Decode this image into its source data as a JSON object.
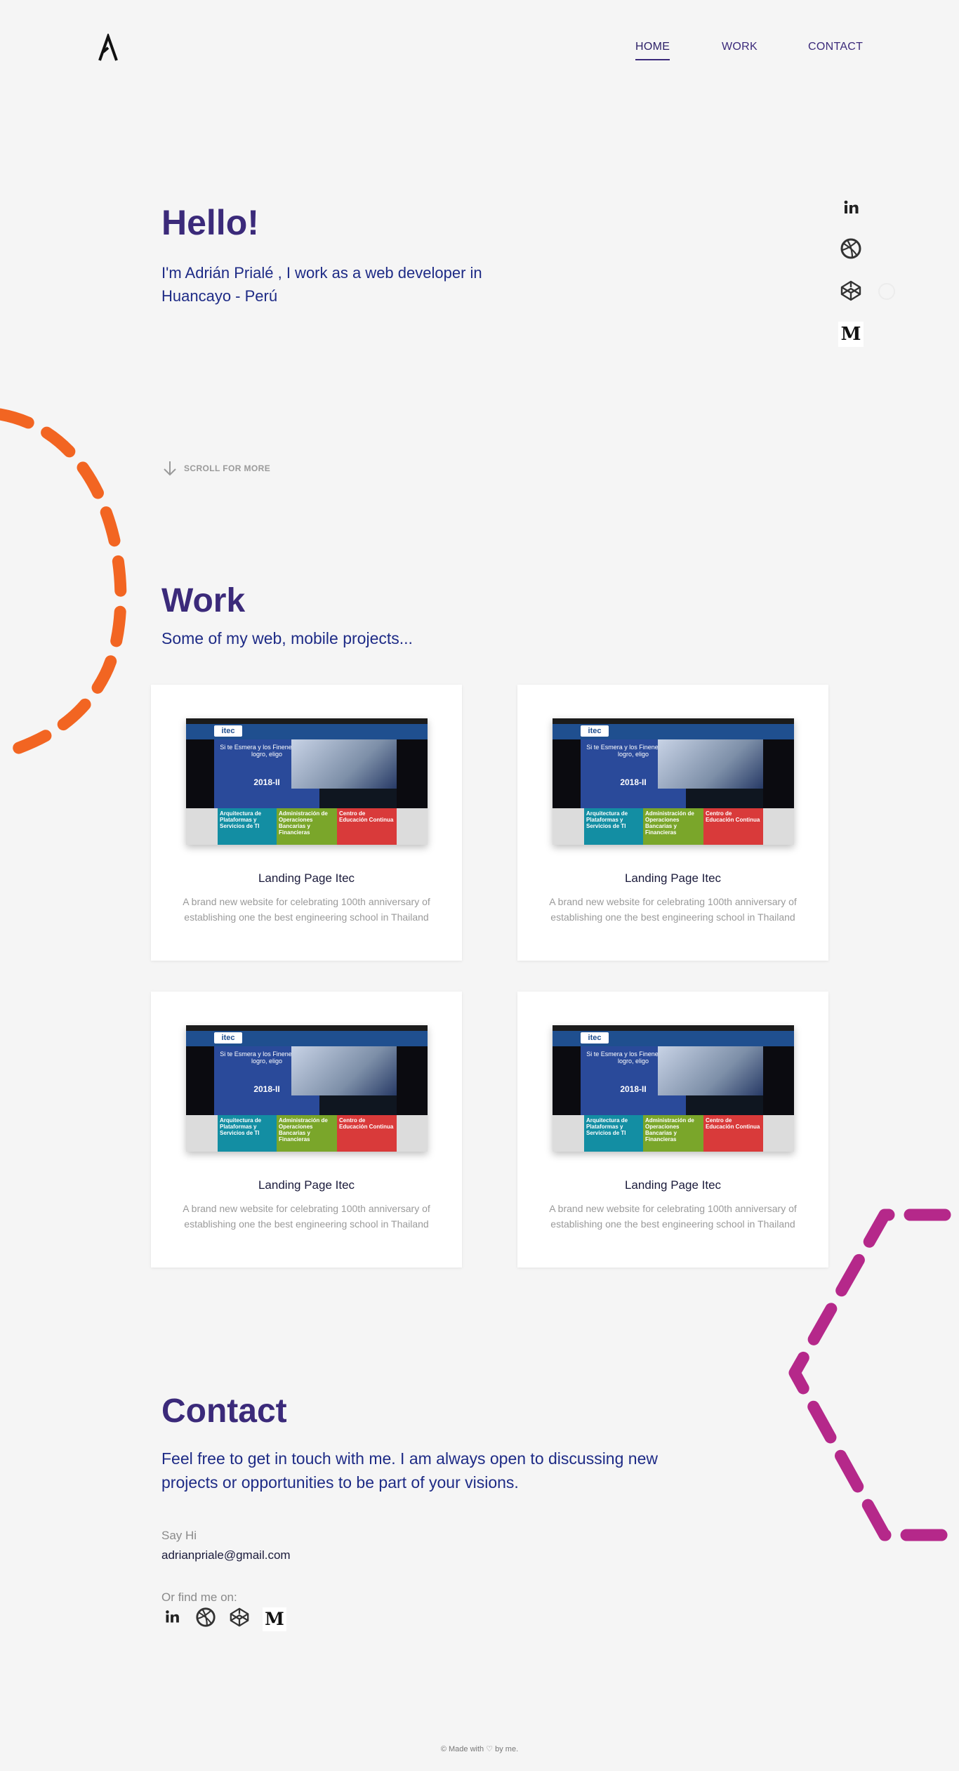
{
  "header": {
    "logo_letter": "A",
    "nav": [
      {
        "label": "HOME",
        "active": true
      },
      {
        "label": "WORK",
        "active": false
      },
      {
        "label": "CONTACT",
        "active": false
      }
    ]
  },
  "hero": {
    "title": "Hello!",
    "intro": "I'm Adrián Prialé , I work as a web developer in Huancayo - Perú",
    "scroll_hint": "SCROLL FOR MORE"
  },
  "social": [
    {
      "name": "linkedin-icon",
      "glyph": "in"
    },
    {
      "name": "dribbble-icon",
      "glyph": ""
    },
    {
      "name": "codepen-icon",
      "glyph": ""
    },
    {
      "name": "medium-icon",
      "glyph": "M"
    }
  ],
  "work": {
    "title": "Work",
    "subtitle": "Some of my web, mobile projects...",
    "projects": [
      {
        "title": "Landing Page Itec",
        "description": "A brand new website for celebrating 100th anniversary of establishing one the best engineering school in Thailand"
      },
      {
        "title": "Landing Page Itec",
        "description": "A brand new website for celebrating 100th anniversary of establishing one the best engineering school in Thailand"
      },
      {
        "title": "Landing Page Itec",
        "description": "A brand new website for celebrating 100th anniversary of establishing one the best engineering school in Thailand"
      },
      {
        "title": "Landing Page Itec",
        "description": "A brand new website for celebrating 100th anniversary of establishing one the best engineering school in Thailand"
      }
    ],
    "screenshot": {
      "brand": "itec",
      "term": "2018-II",
      "tagline": "Si te Esmera y los Fineness en lo logro, eligo",
      "tiles": [
        "Arquitectura de Plataformas y Servicios de TI",
        "Administración de Operaciones Bancarias y Financieras",
        "Centro de Educación Continua"
      ]
    }
  },
  "contact": {
    "title": "Contact",
    "text": "Feel free to get in touch with me. I am always open to discussing new projects or opportunities to be part of your visions.",
    "say_hi_label": "Say Hi",
    "email": "adrianpriale@gmail.com",
    "find_label": "Or find me on:"
  },
  "footer": {
    "text": "© Made with ♡ by me."
  },
  "colors": {
    "accent": "#3b2a7a",
    "text_blue": "#1e2b86",
    "orange": "#f26522",
    "magenta": "#b5288a"
  }
}
